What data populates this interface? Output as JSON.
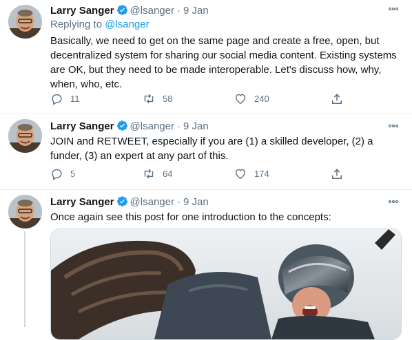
{
  "tweets": [
    {
      "name": "Larry Sanger",
      "handle": "@lsanger",
      "dot": "·",
      "date": "9 Jan",
      "replying_prefix": "Replying to ",
      "replying_handle": "@lsanger",
      "text": "Basically, we need to get on the same page and create a free, open, but decentralized system for sharing our social media content. Existing systems are OK, but they need to be made interoperable. Let's discuss how, why, when, who, etc.",
      "replies": "11",
      "retweets": "58",
      "likes": "240"
    },
    {
      "name": "Larry Sanger",
      "handle": "@lsanger",
      "dot": "·",
      "date": "9 Jan",
      "text": "JOIN and RETWEET, especially if you are (1) a skilled developer, (2) a funder, (3) an expert at any part of this.",
      "replies": "5",
      "retweets": "64",
      "likes": "174"
    },
    {
      "name": "Larry Sanger",
      "handle": "@lsanger",
      "dot": "·",
      "date": "9 Jan",
      "text": "Once again see this post for one introduction to the concepts:"
    }
  ],
  "icons": {
    "verified": "verified-badge-icon",
    "more": "more-icon",
    "reply": "reply-icon",
    "retweet": "retweet-icon",
    "like": "like-icon",
    "share": "share-icon"
  },
  "colors": {
    "link": "#1d9bf0",
    "muted": "#5b7083",
    "verified": "#1d9bf0"
  }
}
